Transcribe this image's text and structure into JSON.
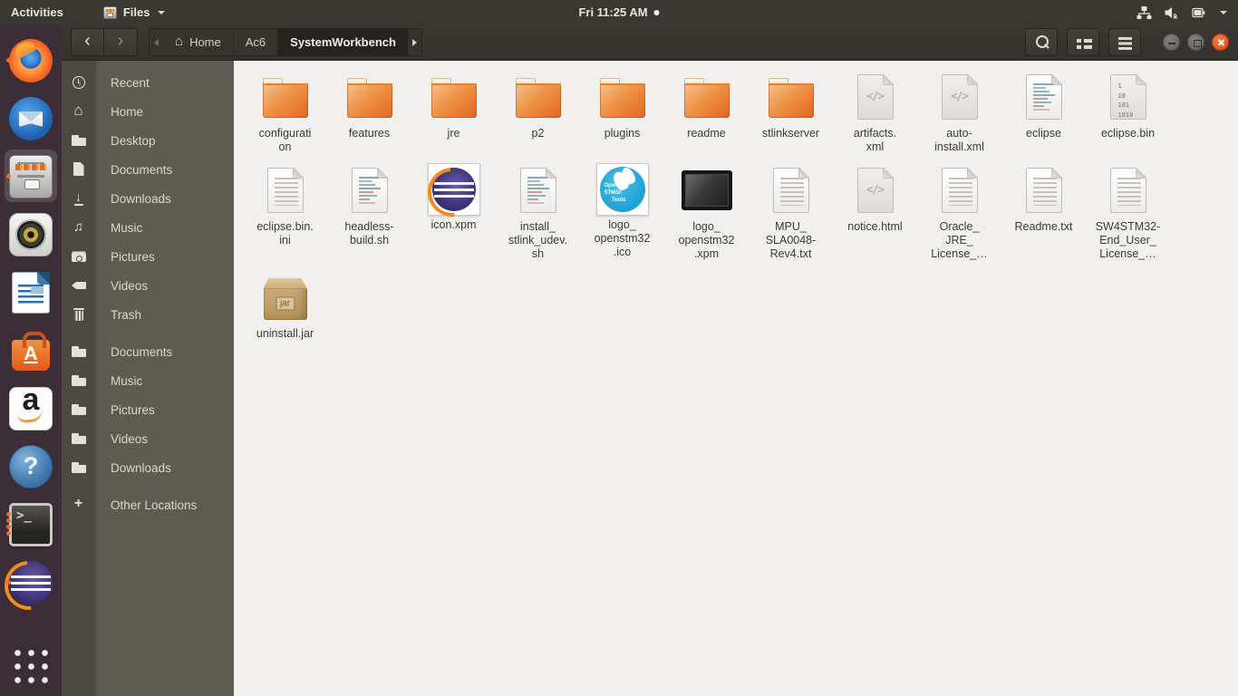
{
  "topbar": {
    "activities": "Activities",
    "app_menu": "Files",
    "clock": "Fri 11:25 AM",
    "tray_icons": [
      "network-icon",
      "volume-muted-icon",
      "battery-icon",
      "chevron-down-icon"
    ]
  },
  "colors": {
    "accent_orange": "#e95420",
    "folder_orange": "#e8701f",
    "dock_background": "#3c2e37",
    "sidebar_background": "#5e5b52",
    "content_background": "#f1f0ee"
  },
  "dock": {
    "items": [
      {
        "app": "firefox",
        "icon": "firefox",
        "dots": 1
      },
      {
        "app": "thunderbird",
        "icon": "thunderbird",
        "dots": 0
      },
      {
        "app": "files",
        "icon": "files",
        "dots": 1,
        "active": true
      },
      {
        "app": "rhythmbox",
        "icon": "rhythmbox",
        "dots": 0
      },
      {
        "app": "libreoffice-writer",
        "icon": "libreoffice-writer",
        "dots": 0
      },
      {
        "app": "ubuntu-software",
        "icon": "ubuntu-software",
        "dots": 0
      },
      {
        "app": "amazon",
        "icon": "amazon",
        "dots": 0
      },
      {
        "app": "help",
        "icon": "help",
        "dots": 0
      },
      {
        "app": "terminal",
        "icon": "terminal",
        "dots": 4
      },
      {
        "app": "eclipse",
        "icon": "eclipse",
        "dots": 1
      }
    ]
  },
  "headerbar": {
    "breadcrumbs": [
      {
        "label": "Home",
        "icon": "home"
      },
      {
        "label": "Ac6"
      },
      {
        "label": "SystemWorkbench",
        "active": true
      }
    ]
  },
  "sidebar": {
    "places": [
      {
        "label": "Recent",
        "icon": "recent"
      },
      {
        "label": "Home",
        "icon": "home"
      },
      {
        "label": "Desktop",
        "icon": "folder"
      },
      {
        "label": "Documents",
        "icon": "doc"
      },
      {
        "label": "Downloads",
        "icon": "download"
      },
      {
        "label": "Music",
        "icon": "music"
      },
      {
        "label": "Pictures",
        "icon": "camera"
      },
      {
        "label": "Videos",
        "icon": "video"
      },
      {
        "label": "Trash",
        "icon": "trash"
      }
    ],
    "bookmarks": [
      {
        "label": "Documents",
        "icon": "folder"
      },
      {
        "label": "Music",
        "icon": "folder"
      },
      {
        "label": "Pictures",
        "icon": "folder"
      },
      {
        "label": "Videos",
        "icon": "folder"
      },
      {
        "label": "Downloads",
        "icon": "folder"
      }
    ],
    "other": [
      {
        "label": "Other Locations",
        "icon": "plus"
      }
    ]
  },
  "files": {
    "items": [
      {
        "label": "configurati\non",
        "icon": "folder"
      },
      {
        "label": "features",
        "icon": "folder"
      },
      {
        "label": "jre",
        "icon": "folder"
      },
      {
        "label": "p2",
        "icon": "folder"
      },
      {
        "label": "plugins",
        "icon": "folder"
      },
      {
        "label": "readme",
        "icon": "folder"
      },
      {
        "label": "stlinkserver",
        "icon": "folder"
      },
      {
        "label": "artifacts.\nxml",
        "icon": "code"
      },
      {
        "label": "auto-\ninstall.xml",
        "icon": "code"
      },
      {
        "label": "eclipse",
        "icon": "script"
      },
      {
        "label": "eclipse.bin",
        "icon": "binary"
      },
      {
        "label": "eclipse.bin.\nini",
        "icon": "text"
      },
      {
        "label": "headless-\nbuild.sh",
        "icon": "script"
      },
      {
        "label": "icon.xpm",
        "icon": "img-eclipse"
      },
      {
        "label": "install_\nstlink_udev.\nsh",
        "icon": "script"
      },
      {
        "label": "logo_\nopenstm32\n.ico",
        "icon": "img-stm32"
      },
      {
        "label": "logo_\nopenstm32\n.xpm",
        "icon": "img-dark"
      },
      {
        "label": "MPU_\nSLA0048-\nRev4.txt",
        "icon": "text"
      },
      {
        "label": "notice.html",
        "icon": "code"
      },
      {
        "label": "Oracle_\nJRE_\nLicense_…",
        "icon": "text"
      },
      {
        "label": "Readme.txt",
        "icon": "text"
      },
      {
        "label": "SW4STM32-\nEnd_User_\nLicense_…",
        "icon": "text"
      },
      {
        "label": "uninstall.jar",
        "icon": "jar"
      }
    ]
  }
}
